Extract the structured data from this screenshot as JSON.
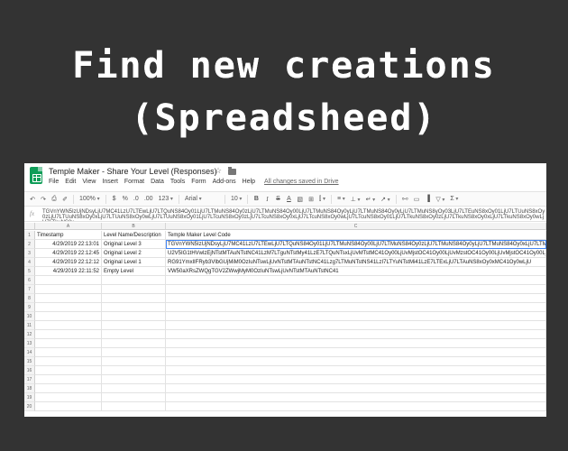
{
  "heading": {
    "line1": "Find new creations",
    "line2": "(Spreadsheed)"
  },
  "app": {
    "doc_title": "Temple Maker - Share Your Level (Responses)",
    "star_icon": "star-icon",
    "folder_icon": "folder-icon",
    "logo": "google-sheets-logo"
  },
  "menu": {
    "items": [
      "File",
      "Edit",
      "View",
      "Insert",
      "Format",
      "Data",
      "Tools",
      "Form",
      "Add-ons",
      "Help"
    ],
    "saved_status": "All changes saved in Drive"
  },
  "toolbar": {
    "undo_icon": "↶",
    "redo_icon": "↷",
    "print_icon": "⎙",
    "paint_icon": "✐",
    "zoom": "100%",
    "currency": "$",
    "percent": "%",
    "decimal_less": ".0",
    "decimal_more": ".00",
    "more_formats": "123",
    "font": "Arial",
    "font_size": "10",
    "bold": "B",
    "italic": "I",
    "strike": "S",
    "text_color": "A",
    "fill_icon": "▧",
    "borders_icon": "⊞",
    "merge_icon": "⫿",
    "halign_icon": "≡",
    "valign_icon": "⊥",
    "wrap_icon": "↵",
    "rotate_icon": "↗",
    "link_icon": "⧟",
    "comment_icon": "▭",
    "chart_icon": "▐",
    "filter_icon": "▽",
    "functions_icon": "Σ"
  },
  "formula_bar": {
    "fx": "fx",
    "content": "TGVnYWN5IzUjNDsyLjU7MC41LzU7LTEwLjU7LTQuNS84Oy01LjU7LTMuNS84Oy0zLjU7LTMuNS84Oy00LjU7LTMuNS84Oy0yLjU7LTMuNS84Oy0yLjU7LTMuNS8yOy03LjU7LTEuNS8xOy01LjU7LTUuNS8xOy0zLjU7LTUuNS8xOy0xLjU7LTUuNS8xOy0wLjU7LTUuNS8xOy01LjU7LTcuNS8xOy0zLjU7LTcuNS8xOy0xLjU7LTcuNS8xOy0wLjU7LTcuNS8xOy01LjU7LTkuNS8xOy0zLjU7LTkuNS8xOy0xLjU7LTkuNS8xOy0wLjU7LTkuNS8x"
  },
  "columns": [
    {
      "letter": "",
      "label": ""
    },
    {
      "letter": "A",
      "label": "Timestamp"
    },
    {
      "letter": "B",
      "label": "Level Name/Description"
    },
    {
      "letter": "C",
      "label": "Temple Maker Level Code"
    }
  ],
  "rows": [
    {
      "num": "1",
      "timestamp": "Timestamp",
      "name": "Level Name/Description",
      "code": "Temple Maker Level Code"
    },
    {
      "num": "2",
      "timestamp": "4/29/2019 22:13:01",
      "name": "Original Level 3",
      "code": "TGVnYWN5IzUjNDsyLjU7MC41LzU7LTEwLjU7LTQuNS84Oy01LjU7LTMuNS84Oy00LjU7LTMuNS84Oy0zLjU7LTMuNS84Oy0yLjU7LTMuNS84Oy0xLjU7LTMuNS84Oy0wLjU7LTMuNS8xOy01LjU7LTUuNS8xOy0zLjU"
    },
    {
      "num": "3",
      "timestamp": "4/29/2019 22:12:45",
      "name": "Original Level 2",
      "code": "U2V5IG1tHVwlzEjNTstMTAuNTstNC41LzM7LTguNTstMy41LzE7LTQuNTsxLjUvMTstMC41Oy00LjUvMjstOC41Oy00LjUvMzstOC41Oy00LjUvMjstOC41Oy00LjU"
    },
    {
      "num": "4",
      "timestamp": "4/29/2019 22:12:12",
      "name": "Original Level 1",
      "code": "RG91YmxlIFRyb3VlbGUjMiM0OzIuNTswLjUvNTstMTAuNTstNC41Lzg7LTMuNTstNS41LzI7LTYuNTstMi41LzE7LTExLjU7LTAuNS8xOy0xMC41Oy0wLjU"
    },
    {
      "num": "5",
      "timestamp": "4/29/2019 22:11:52",
      "name": "Empty Level",
      "code": "VW50aXRsZWQgTGV2ZWwjMyM0OzIuNTswLjUvNTstMTAuNTstNC41"
    },
    {
      "num": "6",
      "timestamp": "",
      "name": "",
      "code": ""
    },
    {
      "num": "7",
      "timestamp": "",
      "name": "",
      "code": ""
    },
    {
      "num": "8",
      "timestamp": "",
      "name": "",
      "code": ""
    },
    {
      "num": "9",
      "timestamp": "",
      "name": "",
      "code": ""
    },
    {
      "num": "10",
      "timestamp": "",
      "name": "",
      "code": ""
    },
    {
      "num": "11",
      "timestamp": "",
      "name": "",
      "code": ""
    },
    {
      "num": "12",
      "timestamp": "",
      "name": "",
      "code": ""
    },
    {
      "num": "13",
      "timestamp": "",
      "name": "",
      "code": ""
    },
    {
      "num": "14",
      "timestamp": "",
      "name": "",
      "code": ""
    },
    {
      "num": "15",
      "timestamp": "",
      "name": "",
      "code": ""
    },
    {
      "num": "16",
      "timestamp": "",
      "name": "",
      "code": ""
    },
    {
      "num": "17",
      "timestamp": "",
      "name": "",
      "code": ""
    },
    {
      "num": "18",
      "timestamp": "",
      "name": "",
      "code": ""
    },
    {
      "num": "19",
      "timestamp": "",
      "name": "",
      "code": ""
    },
    {
      "num": "20",
      "timestamp": "",
      "name": "",
      "code": ""
    }
  ],
  "colors": {
    "background": "#333333",
    "sheets_green": "#0f9d58",
    "selection_blue": "#4285f4"
  }
}
